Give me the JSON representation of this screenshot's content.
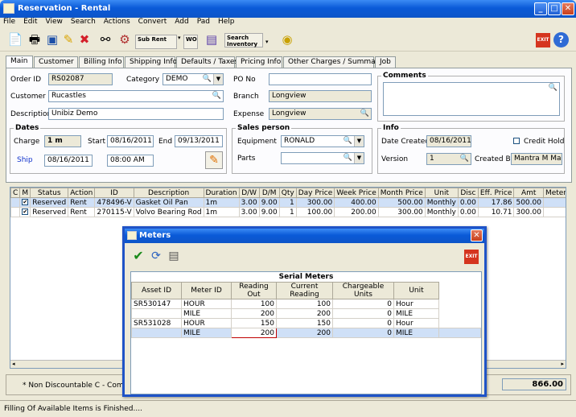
{
  "window": {
    "title": "Reservation - Rental"
  },
  "menu": [
    "File",
    "Edit",
    "View",
    "Search",
    "Actions",
    "Convert",
    "Add",
    "Pad",
    "Help"
  ],
  "toolbar": {
    "sub_rent": "Sub Rent",
    "wo": "WO",
    "search_inventory_1": "Search",
    "search_inventory_2": "Inventory",
    "exit": "EXIT"
  },
  "tabs": [
    "Main",
    "Customer",
    "Billing Info",
    "Shipping Info",
    "Defaults / Taxes",
    "Pricing Info",
    "Other Charges / Summary",
    "Job"
  ],
  "form": {
    "order_id_label": "Order ID",
    "order_id": "RS02087",
    "category_label": "Category",
    "category": "DEMO",
    "customer_label": "Customer",
    "customer": "Rucastles",
    "description_label": "Description",
    "description": "Unibiz Demo",
    "po_label": "PO No",
    "po": "",
    "branch_label": "Branch",
    "branch": "Longview",
    "expense_label": "Expense",
    "expense": "Longview",
    "comments_label": "Comments",
    "dates_label": "Dates",
    "charge_label": "Charge",
    "charge": "1 m",
    "start_label": "Start",
    "start": "08/16/2011",
    "end_label": "End",
    "end": "09/13/2011",
    "ship_label": "Ship",
    "ship_date": "08/16/2011",
    "ship_time": "08:00 AM",
    "salesperson_label": "Sales person",
    "equipment_label": "Equipment",
    "equipment": "RONALD",
    "parts_label": "Parts",
    "parts": "",
    "info_label": "Info",
    "date_created_label": "Date Created",
    "date_created": "08/16/2011",
    "credit_hold_label": "Credit Hold",
    "version_label": "Version",
    "version": "1",
    "created_by_label": "Created By",
    "created_by": "Mantra M Mantra"
  },
  "grid": {
    "headers": [
      "C",
      "M",
      "Status",
      "Action",
      "ID",
      "Description",
      "Duration",
      "D/W",
      "D/M",
      "Qty",
      "Day Price",
      "Week Price",
      "Month Price",
      "Unit",
      "Disc",
      "Eff. Price",
      "Amt",
      "Meter A"
    ],
    "rows": [
      [
        "",
        "✔",
        "Reserved",
        "Rent",
        "478496-V",
        "Gasket Oil Pan",
        "1m",
        "3.00",
        "9.00",
        "1",
        "300.00",
        "400.00",
        "500.00",
        "Monthly",
        "0.00",
        "17.86",
        "500.00",
        ""
      ],
      [
        "",
        "✔",
        "Reserved",
        "Rent",
        "270115-V",
        "Volvo Bearing Rod",
        "1m",
        "3.00",
        "9.00",
        "1",
        "100.00",
        "200.00",
        "300.00",
        "Monthly",
        "0.00",
        "10.71",
        "300.00",
        ""
      ]
    ]
  },
  "footer": {
    "note": "* Non Discountable   C - Comme",
    "total": "866.00"
  },
  "status": "Filling Of Available Items is Finished....",
  "meters": {
    "title": "Meters",
    "exit": "EXIT",
    "section": "Serial Meters",
    "headers": [
      "Asset ID",
      "Meter ID",
      "Reading Out",
      "Current Reading",
      "Chargeable Units",
      "Unit"
    ],
    "rows": [
      [
        "SR530147",
        "HOUR",
        "100",
        "100",
        "0",
        "Hour"
      ],
      [
        "",
        "MILE",
        "200",
        "200",
        "0",
        "MILE"
      ],
      [
        "SR531028",
        "HOUR",
        "150",
        "150",
        "0",
        "Hour"
      ],
      [
        "",
        "MILE",
        "200",
        "200",
        "0",
        "MILE"
      ]
    ]
  }
}
